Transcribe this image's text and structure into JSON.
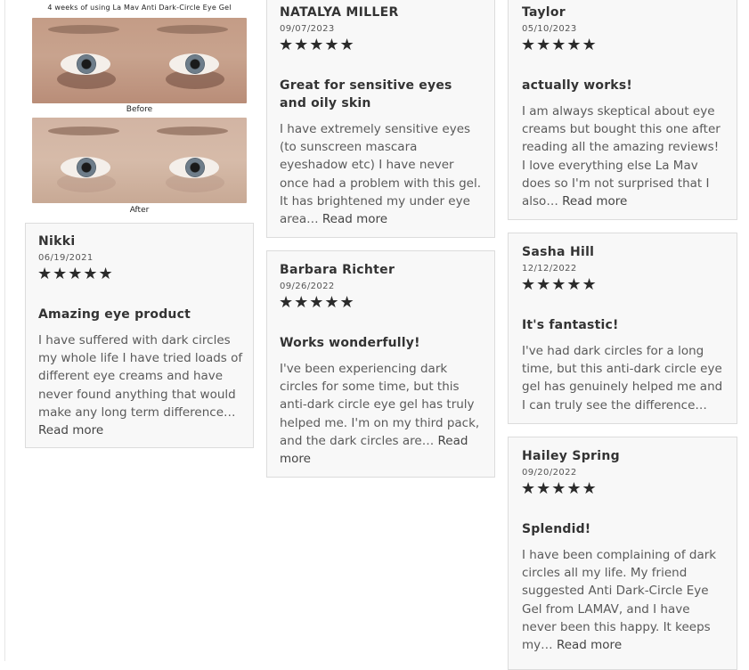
{
  "image_card": {
    "header": "4 weeks of using La Mav Anti Dark-Circle Eye Gel",
    "before_label": "Before",
    "after_label": "After"
  },
  "reviews": [
    {
      "name": "Nikki",
      "date": "06/19/2021",
      "stars": "★★★★★",
      "rating": 5,
      "title": "Amazing eye product",
      "body": "I have suffered with dark circles my whole life I have tried loads of different eye creams and have never found anything that would make any long term difference…",
      "more": "Read more"
    },
    {
      "name": "NATALYA MILLER",
      "date": "09/07/2023",
      "stars": "★★★★★",
      "rating": 5,
      "title": "Great for sensitive eyes and oily skin",
      "body": "I have extremely sensitive eyes (to sunscreen mascara eyeshadow etc) I have never once had a problem with this gel. It has brightened my under eye area…",
      "more": "Read more"
    },
    {
      "name": "Barbara Richter",
      "date": "09/26/2022",
      "stars": "★★★★★",
      "rating": 5,
      "title": "Works wonderfully!",
      "body": "I've been experiencing dark circles for some time, but this anti-dark circle eye gel has truly helped me. I'm on my third pack, and the dark circles are…",
      "more": "Read more"
    },
    {
      "name": "Taylor",
      "date": "05/10/2023",
      "stars": "★★★★★",
      "rating": 5,
      "title": "actually works!",
      "body": "I am always skeptical about eye creams but bought this one after reading all the amazing reviews! I love everything else La Mav does so I'm not surprised that I also…",
      "more": "Read more"
    },
    {
      "name": "Sasha Hill",
      "date": "12/12/2022",
      "stars": "★★★★★",
      "rating": 5,
      "title": "It's fantastic!",
      "body": "I've had dark circles for a long time, but this anti-dark circle eye gel has genuinely helped me and I can truly see the difference…",
      "more": ""
    },
    {
      "name": "Hailey Spring",
      "date": "09/20/2022",
      "stars": "★★★★★",
      "rating": 5,
      "title": "Splendid!",
      "body": "I have been complaining of dark circles all my life. My friend suggested Anti Dark-Circle Eye Gel from LAMAV, and I have never been this happy. It keeps my…",
      "more": "Read more"
    }
  ],
  "colors": {
    "card_background": "#f8f8f8",
    "card_border": "#dcdcdc",
    "star": "#2b2b2b"
  }
}
